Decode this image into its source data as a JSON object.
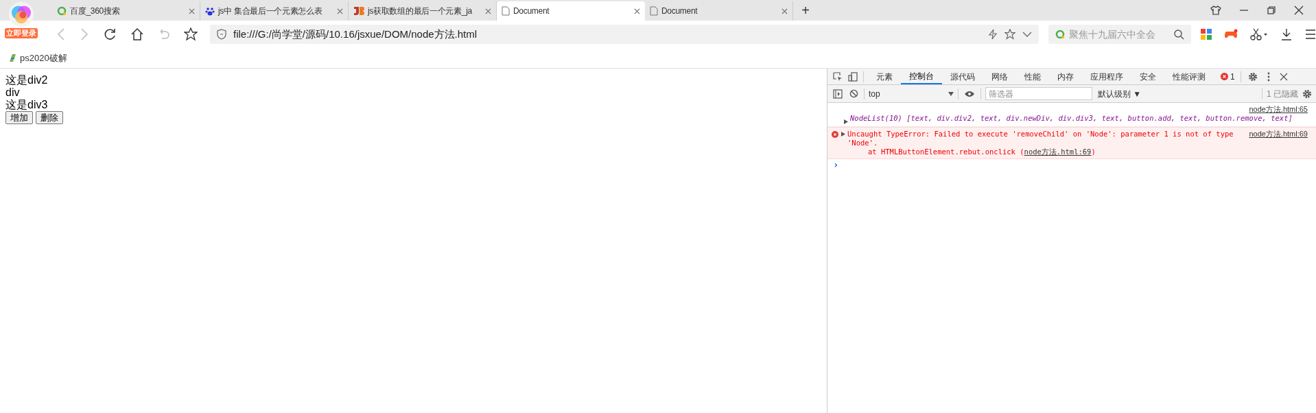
{
  "browser": {
    "account_badge": "立即登录",
    "tabs": [
      {
        "title": "百度_360搜索",
        "selected": false
      },
      {
        "title": "js中 集合最后一个元素怎么表",
        "selected": false
      },
      {
        "title": "js获取数组的最后一个元素_ja",
        "selected": false
      },
      {
        "title": "Document",
        "selected": true
      },
      {
        "title": "Document",
        "selected": false
      }
    ],
    "new_tab": "+",
    "address": "file:///G:/尚学堂/源码/10.16/jsxue/DOM/node方法.html",
    "search_placeholder": "聚焦十九届六中全会",
    "bookmarks": [
      {
        "label": "ps2020破解"
      }
    ]
  },
  "page": {
    "lines": [
      "这是div2",
      "div",
      "这是div3"
    ],
    "buttons": [
      "增加",
      "删除"
    ]
  },
  "devtools": {
    "tabs": [
      {
        "label": "元素",
        "selected": false
      },
      {
        "label": "控制台",
        "selected": true
      },
      {
        "label": "源代码",
        "selected": false
      },
      {
        "label": "网络",
        "selected": false
      },
      {
        "label": "性能",
        "selected": false
      },
      {
        "label": "内存",
        "selected": false
      },
      {
        "label": "应用程序",
        "selected": false
      },
      {
        "label": "安全",
        "selected": false
      },
      {
        "label": "性能评测",
        "selected": false
      }
    ],
    "error_count": "1",
    "context": "top",
    "filter_placeholder": "筛选器",
    "level_menu": "默认级别 ▼",
    "hidden_count": "1 已隐藏",
    "messages": [
      {
        "kind": "log",
        "source": "node方法.html:65",
        "text": "NodeList(10) [text, div.div2, text, div.newDiv, div.div3, text, button.add, text, button.remove, text]"
      },
      {
        "kind": "error",
        "source": "node方法.html:69",
        "text": "Uncaught TypeError: Failed to execute 'removeChild' on 'Node': parameter 1 is not of type 'Node'.",
        "stack": "at HTMLButtonElement.rebut.onclick (",
        "stack_link": "node方法.html:69",
        "stack_end": ")"
      }
    ],
    "prompt": "›"
  }
}
